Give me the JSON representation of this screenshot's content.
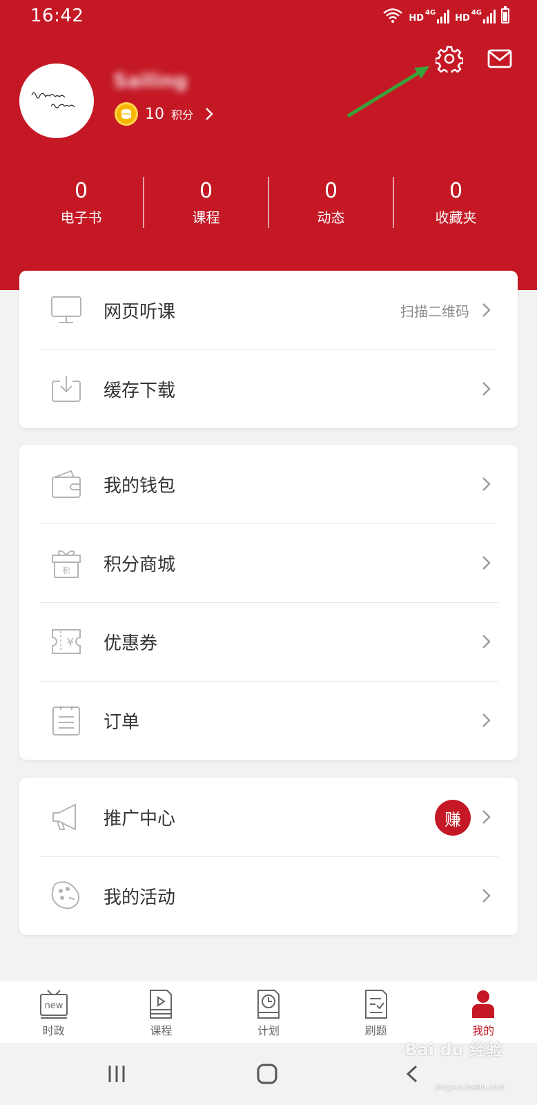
{
  "status_bar": {
    "time": "16:42",
    "hd_1": "HD",
    "network_1": "4G",
    "hd_2": "HD",
    "network_2": "4G"
  },
  "profile": {
    "username": "Sailing",
    "points_value": "10",
    "points_unit": "积分"
  },
  "stats": [
    {
      "value": "0",
      "label": "电子书"
    },
    {
      "value": "0",
      "label": "课程"
    },
    {
      "value": "0",
      "label": "动态"
    },
    {
      "value": "0",
      "label": "收藏夹"
    }
  ],
  "menu_group_1": [
    {
      "label": "网页听课",
      "right_text": "扫描二维码",
      "icon": "monitor-icon"
    },
    {
      "label": "缓存下载",
      "icon": "download-icon"
    }
  ],
  "menu_group_2": [
    {
      "label": "我的钱包",
      "icon": "wallet-icon"
    },
    {
      "label": "积分商城",
      "icon": "gift-icon",
      "icon_text": "积"
    },
    {
      "label": "优惠券",
      "icon": "coupon-icon",
      "icon_text": "¥"
    },
    {
      "label": "订单",
      "icon": "order-icon"
    }
  ],
  "menu_group_3": [
    {
      "label": "推广中心",
      "badge": "赚",
      "icon": "megaphone-icon"
    },
    {
      "label": "我的活动",
      "icon": "activity-icon"
    }
  ],
  "tabbar": [
    {
      "label": "时政",
      "icon": "news-tv-icon",
      "icon_text": "new"
    },
    {
      "label": "课程",
      "icon": "course-icon"
    },
    {
      "label": "计划",
      "icon": "plan-icon"
    },
    {
      "label": "刷题",
      "icon": "exercise-icon"
    },
    {
      "label": "我的",
      "icon": "profile-icon",
      "active": true
    }
  ],
  "watermark": {
    "brand": "Bai du 经验",
    "url": "jingyan.baidu.com"
  },
  "colors": {
    "primary": "#c41825",
    "coin": "#f6b700",
    "background": "#f2f2f2",
    "icon_gray": "#b5b5b5",
    "arrow_annotation": "#3aa23a"
  }
}
